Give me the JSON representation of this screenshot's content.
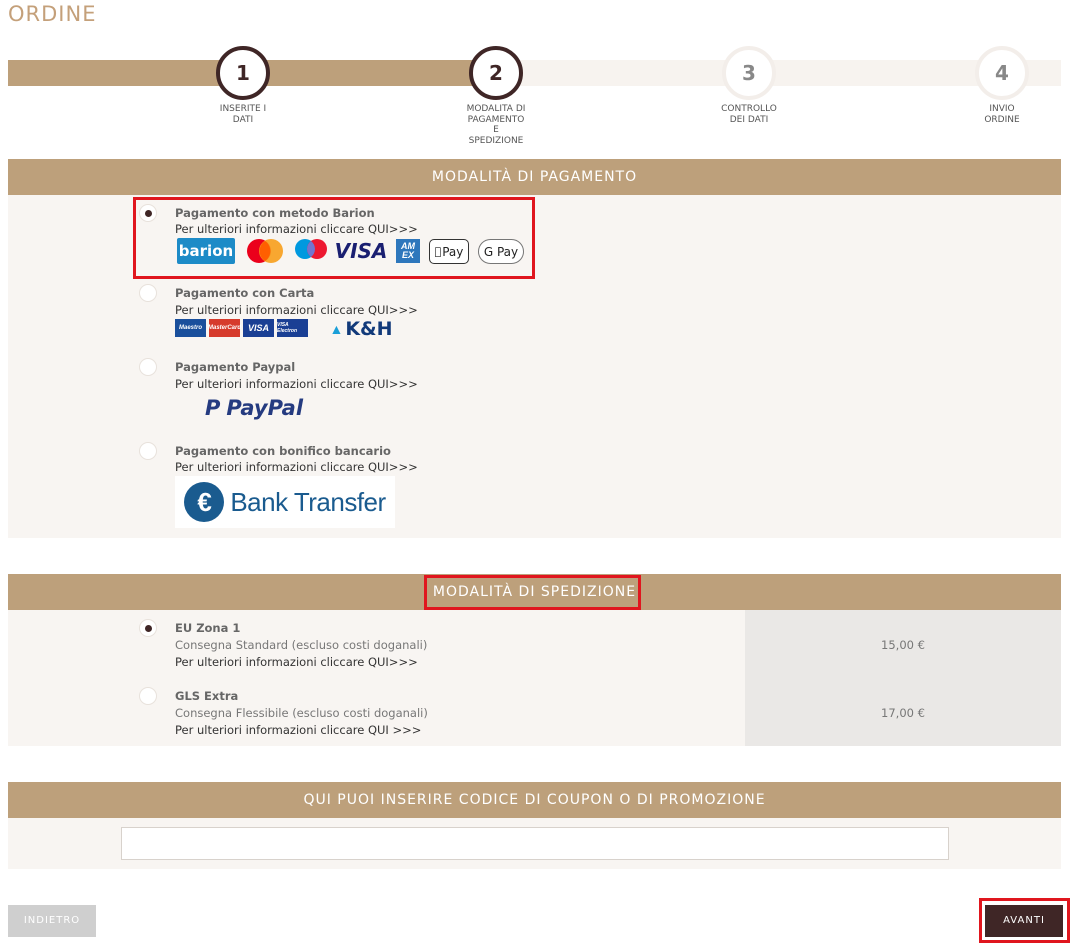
{
  "page": {
    "title": "ORDINE"
  },
  "steps": [
    {
      "number": "1",
      "label": "INSERITE I DATI"
    },
    {
      "number": "2",
      "label": "MODALITA DI PAGAMENTO E SPEDIZIONE"
    },
    {
      "number": "3",
      "label": "CONTROLLO DEI DATI"
    },
    {
      "number": "4",
      "label": "INVIO ORDINE"
    }
  ],
  "progress": {
    "active_step": 2,
    "total_steps": 4
  },
  "payment": {
    "header": "MODALITÀ DI PAGAMENTO",
    "options": [
      {
        "title": "Pagamento con metodo Barion",
        "info": "Per ulteriori informazioni cliccare QUI>>>",
        "selected": true,
        "logos": {
          "barion": "barion",
          "visa": "VISA",
          "amex": "AM EX",
          "apple_pay": "Pay",
          "google_pay": "G Pay"
        }
      },
      {
        "title": "Pagamento con Carta",
        "info": "Per ulteriori informazioni cliccare QUI>>>",
        "selected": false,
        "logos": {
          "maestro": "Maestro",
          "mastercard": "MasterCard",
          "visa": "VISA",
          "visa_electron": "VISA Electron",
          "kh": "K&H"
        }
      },
      {
        "title": "Pagamento Paypal",
        "info": "Per ulteriori informazioni cliccare QUI>>>",
        "selected": false,
        "logos": {
          "paypal": "PayPal"
        }
      },
      {
        "title": "Pagamento con bonifico bancario",
        "info": "Per ulteriori informazioni cliccare QUI>>>",
        "selected": false,
        "logos": {
          "bank_transfer": "Bank Transfer",
          "euro": "€"
        }
      }
    ]
  },
  "shipping": {
    "header": "MODALITÀ DI SPEDIZIONE",
    "options": [
      {
        "title": "EU Zona 1",
        "desc": "Consegna Standard (escluso costi doganali)",
        "info": "Per ulteriori informazioni cliccare QUI>>>",
        "price": "15,00 €",
        "selected": true
      },
      {
        "title": "GLS Extra",
        "desc": "Consegna Flessibile (escluso costi doganali)",
        "info": "Per ulteriori informazioni cliccare QUI >>>",
        "price": "17,00 €",
        "selected": false
      }
    ]
  },
  "coupon": {
    "header": "QUI PUOI INSERIRE CODICE DI COUPON O DI PROMOZIONE",
    "value": "",
    "placeholder": ""
  },
  "buttons": {
    "back": "INDIETRO",
    "next": "AVANTI"
  },
  "colors": {
    "accent": "#bda07b",
    "dark": "#3f2626",
    "highlight": "#e0161e",
    "panel": "#f8f5f2"
  }
}
